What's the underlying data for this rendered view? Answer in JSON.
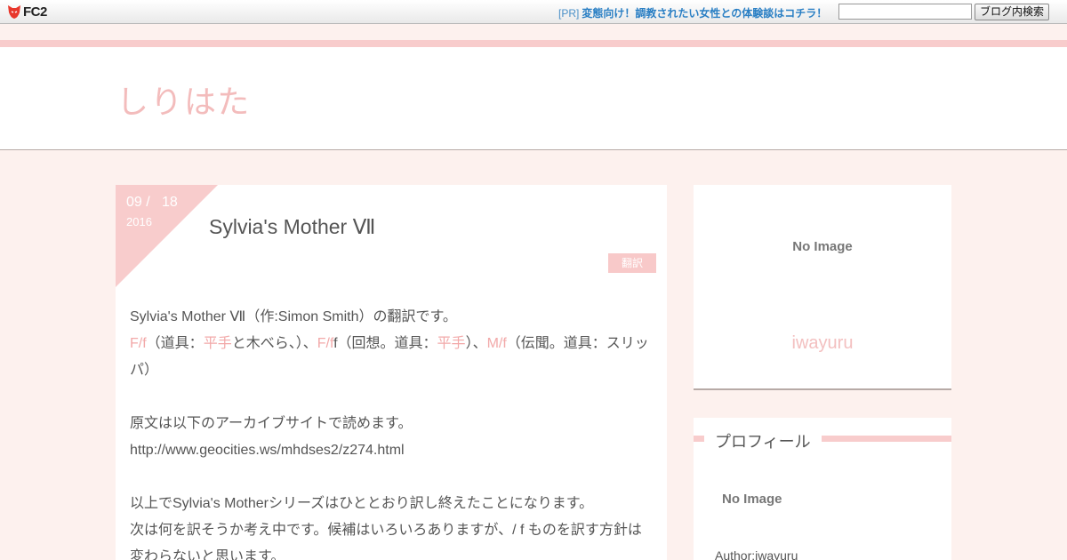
{
  "fc2bar": {
    "logo_text": "FC2",
    "pr_tag": "[PR]",
    "pr_text": "変態向け！調教されたい女性との体験談はコチラ！",
    "search_placeholder": "",
    "search_button": "ブログ内検索"
  },
  "header": {
    "blog_title": "しりはた"
  },
  "article": {
    "date_md": "09 /   18",
    "date_year": "2016",
    "title": "Sylvia's Mother Ⅶ",
    "category": "翻訳",
    "line1": "Sylvia's Mother Ⅶ（作:Simon Smith）の翻訳です。",
    "tag_ff": "F/f",
    "seg_1": "（道具：",
    "tag_hirate1": "平手",
    "seg_2": "と木べら、）、",
    "tag_ff2": "F/f",
    "seg_3": "f（回想。道具：",
    "tag_hirate2": "平手",
    "seg_4": "）、",
    "tag_mf": "M/f",
    "seg_5": "（伝聞。道具：スリッパ）",
    "line_archive": "原文は以下のアーカイブサイトで読めます。",
    "line_url": "http://www.geocities.ws/mhdses2/z274.html",
    "line_done": "以上でSylvia's Motherシリーズはひととおり訳し終えたことになります。",
    "line_next": "次は何を訳そうか考え中です。候補はいろいろありますが、/ f ものを訳す方針は変わらないと思います。"
  },
  "sidebar": {
    "noimage_big": "No Image",
    "author_name": "iwayuru",
    "profile_heading": "プロフィール",
    "noimage_small": "No Image",
    "author_line": "Author:iwayuru"
  },
  "colors": {
    "accent_pink": "#f8cccc",
    "background": "#fdf1ee",
    "link_blue": "#2a7fc4"
  }
}
